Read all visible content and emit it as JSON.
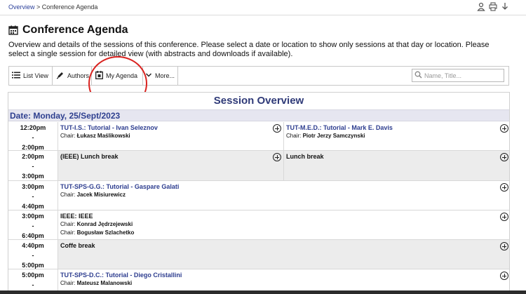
{
  "breadcrumb": {
    "link": "Overview",
    "separator": " > ",
    "current": "Conference Agenda"
  },
  "top_icons": [
    "person-icon",
    "print-icon",
    "download-icon"
  ],
  "page": {
    "title": "Conference Agenda",
    "intro": "Overview and details of the sessions of this conference. Please select a date or location to show only sessions at that day or location. Please select a single session for detailed view (with abstracts and downloads if available)."
  },
  "toolbar": {
    "list_view": "List View",
    "authors": "Authors",
    "my_agenda": "My Agenda",
    "more": "More...",
    "search_placeholder": "Name, Title..."
  },
  "overview_title": "Session Overview",
  "date_label": "Date: Monday, 25/Sept/2023",
  "slots": [
    {
      "start": "12:20pm",
      "dash": "-",
      "end": "2:00pm",
      "sessions": [
        {
          "title": "TUT-I.S.: Tutorial - Ivan Seleznov",
          "chair_prefix": "Chair:",
          "chairs": [
            "Łukasz Maślikowski"
          ]
        },
        {
          "title": "TUT-M.E.D.: Tutorial - Mark E. Davis",
          "chair_prefix": "Chair:",
          "chairs": [
            "Piotr Jerzy Samczynski"
          ]
        }
      ]
    },
    {
      "start": "2:00pm",
      "dash": "-",
      "end": "3:00pm",
      "sessions": [
        {
          "title": "(IEEE) Lunch break",
          "chairs": []
        },
        {
          "title": "Lunch break",
          "chairs": []
        }
      ]
    },
    {
      "start": "3:00pm",
      "dash": "-",
      "end": "4:40pm",
      "sessions": [
        {
          "title": "TUT-SPS-G.G.: Tutorial - Gaspare Galati",
          "chair_prefix": "Chair:",
          "chairs": [
            "Jacek Misiurewicz"
          ]
        }
      ]
    },
    {
      "start": "3:00pm",
      "dash": "-",
      "end": "6:40pm",
      "sessions": [
        {
          "title": "IEEE: IEEE",
          "chair_prefix": "Chair:",
          "chairs": [
            "Konrad Jędrzejewski",
            "Bogusław Szlachetko"
          ]
        }
      ]
    },
    {
      "start": "4:40pm",
      "dash": "-",
      "end": "5:00pm",
      "sessions": [
        {
          "title": "Coffe break",
          "chairs": []
        }
      ]
    },
    {
      "start": "5:00pm",
      "dash": "-",
      "end": "",
      "sessions": [
        {
          "title": "TUT-SPS-D.C.: Tutorial - Diego Cristallini",
          "chair_prefix": "Chair:",
          "chairs": [
            "Mateusz Malanowski"
          ]
        }
      ]
    }
  ],
  "colors": {
    "link_blue": "#2d3d8f",
    "annotation_red": "#d9221f",
    "gray_cell": "#ececec"
  }
}
